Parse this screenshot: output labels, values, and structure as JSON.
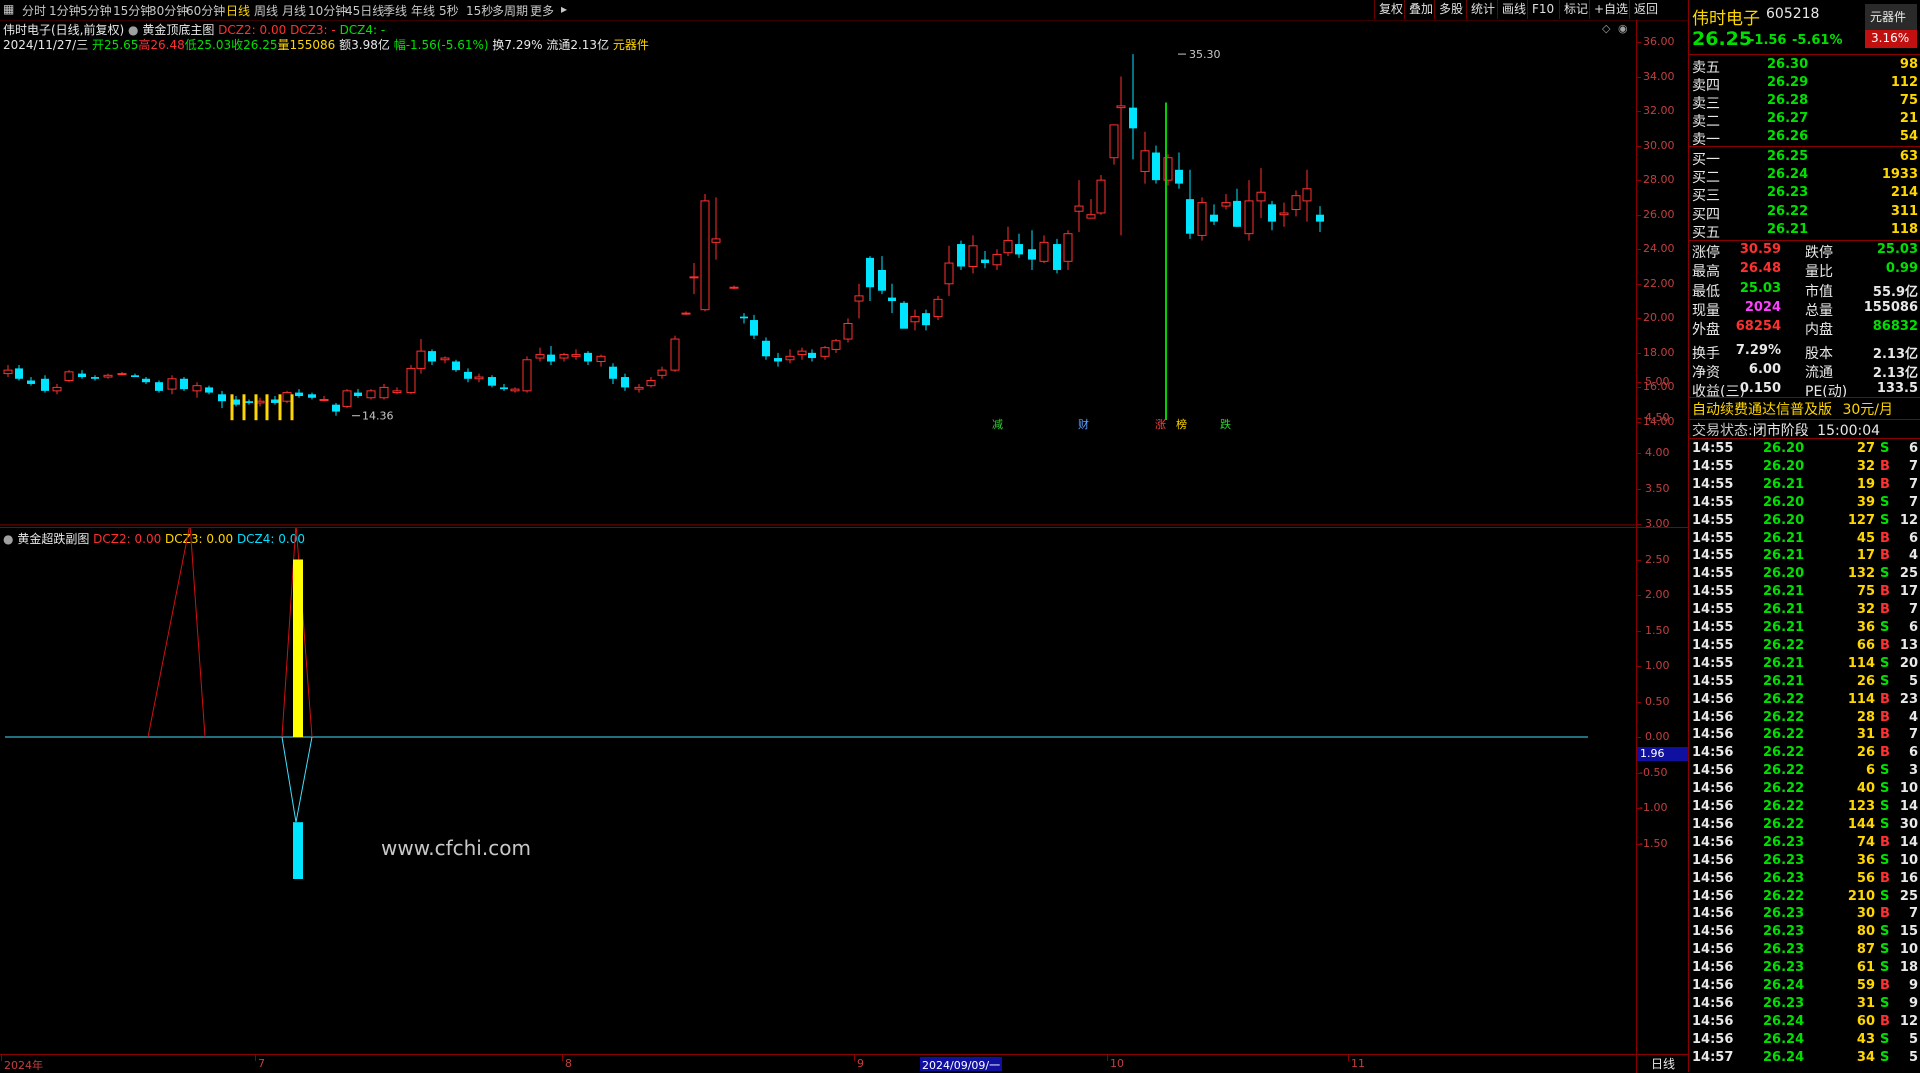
{
  "toolbar": {
    "periods": [
      "分时",
      "1分钟",
      "5分钟",
      "15分钟",
      "30分钟",
      "60分钟",
      "日线",
      "周线",
      "月线",
      "10分钟",
      "45日线",
      "季线",
      "年线",
      "5秒",
      "15秒",
      "多周期",
      "更多"
    ],
    "active_period": "日线",
    "buttons": [
      "复权",
      "叠加",
      "多股",
      "统计",
      "画线",
      "F10",
      "标记",
      "+自选",
      "返回"
    ]
  },
  "main_chart": {
    "title": "伟时电子(日线,前复权)",
    "indicator_name": "黄金顶底主图",
    "indicator_values": {
      "dcz2": "DCZ2: 0.00",
      "dcz3": "DCZ3: -",
      "dcz4": "DCZ4: -"
    },
    "date_line": "2024/11/27/三",
    "open": "开25.65",
    "high": "高26.48",
    "low": "低25.03",
    "close": "收26.25",
    "volume": "量155086",
    "amount": "额3.98亿",
    "change": "幅-1.56(-5.61%)",
    "turnover": "换7.29%",
    "float": "流通2.13亿",
    "component": "元器件",
    "high_label": "35.30",
    "low_label": "14.36",
    "signals": [
      "减",
      "财",
      "涨",
      "榜",
      "跌"
    ],
    "y_ticks": [
      "36.00",
      "34.00",
      "32.00",
      "30.00",
      "28.00",
      "26.00",
      "24.00",
      "22.00",
      "20.00",
      "18.00",
      "16.00",
      "14.00"
    ]
  },
  "sub_chart": {
    "indicator_name": "黄金超跌副图",
    "values": {
      "dcz2": "DCZ2: 0.00",
      "dcz3": "DCZ3: 0.00",
      "dcz4": "DCZ4: 0.00"
    },
    "watermark": "www.cfchi.com",
    "y_ticks": [
      "5.00",
      "4.50",
      "4.00",
      "3.50",
      "3.00",
      "2.50",
      "2.00",
      "1.50",
      "1.00",
      "0.50",
      "0.00",
      "-0.50",
      "-1.00",
      "-1.50"
    ],
    "cursor_value": "1.96"
  },
  "x_axis": {
    "labels": [
      "2024年",
      "7",
      "8",
      "9",
      "10",
      "11"
    ],
    "highlight": "2024/09/09/一",
    "mode": "日线"
  },
  "stock": {
    "name": "伟时电子",
    "code": "605218",
    "sector": "元器件",
    "price": "26.25",
    "change": "-1.56",
    "pct": "-5.61%",
    "sector_pct": "3.16%"
  },
  "order_book": {
    "asks": [
      {
        "label": "卖五",
        "price": "26.30",
        "vol": "98"
      },
      {
        "label": "卖四",
        "price": "26.29",
        "vol": "112"
      },
      {
        "label": "卖三",
        "price": "26.28",
        "vol": "75"
      },
      {
        "label": "卖二",
        "price": "26.27",
        "vol": "21"
      },
      {
        "label": "卖一",
        "price": "26.26",
        "vol": "54"
      }
    ],
    "bids": [
      {
        "label": "买一",
        "price": "26.25",
        "vol": "63"
      },
      {
        "label": "买二",
        "price": "26.24",
        "vol": "1933"
      },
      {
        "label": "买三",
        "price": "26.23",
        "vol": "214"
      },
      {
        "label": "买四",
        "price": "26.22",
        "vol": "311"
      },
      {
        "label": "买五",
        "price": "26.21",
        "vol": "118"
      }
    ]
  },
  "stats": [
    {
      "l1": "涨停",
      "v1": "30.59",
      "c1": "#ff3030",
      "l2": "跌停",
      "v2": "25.03",
      "c2": "#00e000"
    },
    {
      "l1": "最高",
      "v1": "26.48",
      "c1": "#ff3030",
      "l2": "量比",
      "v2": "0.99",
      "c2": "#00e000"
    },
    {
      "l1": "最低",
      "v1": "25.03",
      "c1": "#00e000",
      "l2": "市值",
      "v2": "55.9亿",
      "c2": "#e8e8e8"
    },
    {
      "l1": "现量",
      "v1": "2024",
      "c1": "#ff40ff",
      "l2": "总量",
      "v2": "155086",
      "c2": "#e8e8e8"
    },
    {
      "l1": "外盘",
      "v1": "68254",
      "c1": "#ff3030",
      "l2": "内盘",
      "v2": "86832",
      "c2": "#00e000"
    },
    {
      "l1": "换手",
      "v1": "7.29%",
      "c1": "#e8e8e8",
      "l2": "股本",
      "v2": "2.13亿",
      "c2": "#e8e8e8"
    },
    {
      "l1": "净资",
      "v1": "6.00",
      "c1": "#e8e8e8",
      "l2": "流通",
      "v2": "2.13亿",
      "c2": "#e8e8e8"
    },
    {
      "l1": "收益(三)",
      "v1": "0.150",
      "c1": "#e8e8e8",
      "l2": "PE(动)",
      "v2": "133.5",
      "c2": "#e8e8e8"
    }
  ],
  "promo": {
    "text": "自动续费通达信普及版",
    "price": "30元/月"
  },
  "trade_status": {
    "label": "交易状态:",
    "status": "闭市阶段",
    "time": "15:00:04"
  },
  "ticks": [
    [
      "14:55",
      "26.20",
      "27",
      "S",
      "6"
    ],
    [
      "14:55",
      "26.20",
      "32",
      "B",
      "7"
    ],
    [
      "14:55",
      "26.21",
      "19",
      "B",
      "7"
    ],
    [
      "14:55",
      "26.20",
      "39",
      "S",
      "7"
    ],
    [
      "14:55",
      "26.20",
      "127",
      "S",
      "12"
    ],
    [
      "14:55",
      "26.21",
      "45",
      "B",
      "6"
    ],
    [
      "14:55",
      "26.21",
      "17",
      "B",
      "4"
    ],
    [
      "14:55",
      "26.20",
      "132",
      "S",
      "25"
    ],
    [
      "14:55",
      "26.21",
      "75",
      "B",
      "17"
    ],
    [
      "14:55",
      "26.21",
      "32",
      "B",
      "7"
    ],
    [
      "14:55",
      "26.21",
      "36",
      "S",
      "6"
    ],
    [
      "14:55",
      "26.22",
      "66",
      "B",
      "13"
    ],
    [
      "14:55",
      "26.21",
      "114",
      "S",
      "20"
    ],
    [
      "14:55",
      "26.21",
      "26",
      "S",
      "5"
    ],
    [
      "14:56",
      "26.22",
      "114",
      "B",
      "23"
    ],
    [
      "14:56",
      "26.22",
      "28",
      "B",
      "4"
    ],
    [
      "14:56",
      "26.22",
      "31",
      "B",
      "7"
    ],
    [
      "14:56",
      "26.22",
      "26",
      "B",
      "6"
    ],
    [
      "14:56",
      "26.22",
      "6",
      "S",
      "3"
    ],
    [
      "14:56",
      "26.22",
      "40",
      "S",
      "10"
    ],
    [
      "14:56",
      "26.22",
      "123",
      "S",
      "14"
    ],
    [
      "14:56",
      "26.22",
      "144",
      "S",
      "30"
    ],
    [
      "14:56",
      "26.23",
      "74",
      "B",
      "14"
    ],
    [
      "14:56",
      "26.23",
      "36",
      "S",
      "10"
    ],
    [
      "14:56",
      "26.23",
      "56",
      "B",
      "16"
    ],
    [
      "14:56",
      "26.22",
      "210",
      "S",
      "25"
    ],
    [
      "14:56",
      "26.23",
      "30",
      "B",
      "7"
    ],
    [
      "14:56",
      "26.23",
      "80",
      "S",
      "15"
    ],
    [
      "14:56",
      "26.23",
      "87",
      "S",
      "10"
    ],
    [
      "14:56",
      "26.23",
      "61",
      "S",
      "18"
    ],
    [
      "14:56",
      "26.24",
      "59",
      "B",
      "9"
    ],
    [
      "14:56",
      "26.23",
      "31",
      "S",
      "9"
    ],
    [
      "14:56",
      "26.24",
      "60",
      "B",
      "12"
    ],
    [
      "14:56",
      "26.24",
      "43",
      "S",
      "5"
    ],
    [
      "14:57",
      "26.24",
      "34",
      "S",
      "5"
    ]
  ],
  "colors": {
    "up": "#ff3030",
    "down": "#00e5ff",
    "frame": "#8a0000",
    "background": "#000000",
    "warn": "#ffd700"
  }
}
